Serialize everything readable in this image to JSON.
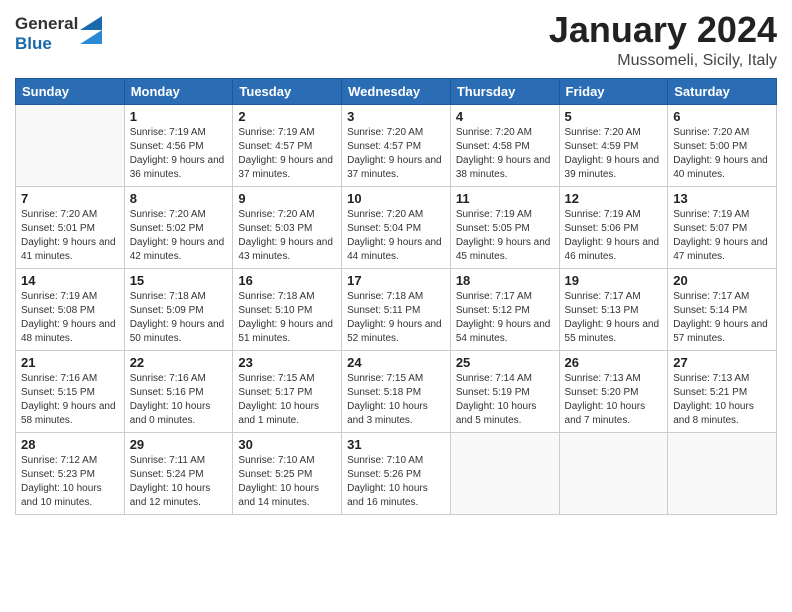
{
  "header": {
    "logo_general": "General",
    "logo_blue": "Blue",
    "month_title": "January 2024",
    "location": "Mussomeli, Sicily, Italy"
  },
  "days_of_week": [
    "Sunday",
    "Monday",
    "Tuesday",
    "Wednesday",
    "Thursday",
    "Friday",
    "Saturday"
  ],
  "weeks": [
    [
      {
        "day": "",
        "sunrise": "",
        "sunset": "",
        "daylight": "",
        "empty": true
      },
      {
        "day": "1",
        "sunrise": "Sunrise: 7:19 AM",
        "sunset": "Sunset: 4:56 PM",
        "daylight": "Daylight: 9 hours and 36 minutes."
      },
      {
        "day": "2",
        "sunrise": "Sunrise: 7:19 AM",
        "sunset": "Sunset: 4:57 PM",
        "daylight": "Daylight: 9 hours and 37 minutes."
      },
      {
        "day": "3",
        "sunrise": "Sunrise: 7:20 AM",
        "sunset": "Sunset: 4:57 PM",
        "daylight": "Daylight: 9 hours and 37 minutes."
      },
      {
        "day": "4",
        "sunrise": "Sunrise: 7:20 AM",
        "sunset": "Sunset: 4:58 PM",
        "daylight": "Daylight: 9 hours and 38 minutes."
      },
      {
        "day": "5",
        "sunrise": "Sunrise: 7:20 AM",
        "sunset": "Sunset: 4:59 PM",
        "daylight": "Daylight: 9 hours and 39 minutes."
      },
      {
        "day": "6",
        "sunrise": "Sunrise: 7:20 AM",
        "sunset": "Sunset: 5:00 PM",
        "daylight": "Daylight: 9 hours and 40 minutes."
      }
    ],
    [
      {
        "day": "7",
        "sunrise": "Sunrise: 7:20 AM",
        "sunset": "Sunset: 5:01 PM",
        "daylight": "Daylight: 9 hours and 41 minutes."
      },
      {
        "day": "8",
        "sunrise": "Sunrise: 7:20 AM",
        "sunset": "Sunset: 5:02 PM",
        "daylight": "Daylight: 9 hours and 42 minutes."
      },
      {
        "day": "9",
        "sunrise": "Sunrise: 7:20 AM",
        "sunset": "Sunset: 5:03 PM",
        "daylight": "Daylight: 9 hours and 43 minutes."
      },
      {
        "day": "10",
        "sunrise": "Sunrise: 7:20 AM",
        "sunset": "Sunset: 5:04 PM",
        "daylight": "Daylight: 9 hours and 44 minutes."
      },
      {
        "day": "11",
        "sunrise": "Sunrise: 7:19 AM",
        "sunset": "Sunset: 5:05 PM",
        "daylight": "Daylight: 9 hours and 45 minutes."
      },
      {
        "day": "12",
        "sunrise": "Sunrise: 7:19 AM",
        "sunset": "Sunset: 5:06 PM",
        "daylight": "Daylight: 9 hours and 46 minutes."
      },
      {
        "day": "13",
        "sunrise": "Sunrise: 7:19 AM",
        "sunset": "Sunset: 5:07 PM",
        "daylight": "Daylight: 9 hours and 47 minutes."
      }
    ],
    [
      {
        "day": "14",
        "sunrise": "Sunrise: 7:19 AM",
        "sunset": "Sunset: 5:08 PM",
        "daylight": "Daylight: 9 hours and 48 minutes."
      },
      {
        "day": "15",
        "sunrise": "Sunrise: 7:18 AM",
        "sunset": "Sunset: 5:09 PM",
        "daylight": "Daylight: 9 hours and 50 minutes."
      },
      {
        "day": "16",
        "sunrise": "Sunrise: 7:18 AM",
        "sunset": "Sunset: 5:10 PM",
        "daylight": "Daylight: 9 hours and 51 minutes."
      },
      {
        "day": "17",
        "sunrise": "Sunrise: 7:18 AM",
        "sunset": "Sunset: 5:11 PM",
        "daylight": "Daylight: 9 hours and 52 minutes."
      },
      {
        "day": "18",
        "sunrise": "Sunrise: 7:17 AM",
        "sunset": "Sunset: 5:12 PM",
        "daylight": "Daylight: 9 hours and 54 minutes."
      },
      {
        "day": "19",
        "sunrise": "Sunrise: 7:17 AM",
        "sunset": "Sunset: 5:13 PM",
        "daylight": "Daylight: 9 hours and 55 minutes."
      },
      {
        "day": "20",
        "sunrise": "Sunrise: 7:17 AM",
        "sunset": "Sunset: 5:14 PM",
        "daylight": "Daylight: 9 hours and 57 minutes."
      }
    ],
    [
      {
        "day": "21",
        "sunrise": "Sunrise: 7:16 AM",
        "sunset": "Sunset: 5:15 PM",
        "daylight": "Daylight: 9 hours and 58 minutes."
      },
      {
        "day": "22",
        "sunrise": "Sunrise: 7:16 AM",
        "sunset": "Sunset: 5:16 PM",
        "daylight": "Daylight: 10 hours and 0 minutes."
      },
      {
        "day": "23",
        "sunrise": "Sunrise: 7:15 AM",
        "sunset": "Sunset: 5:17 PM",
        "daylight": "Daylight: 10 hours and 1 minute."
      },
      {
        "day": "24",
        "sunrise": "Sunrise: 7:15 AM",
        "sunset": "Sunset: 5:18 PM",
        "daylight": "Daylight: 10 hours and 3 minutes."
      },
      {
        "day": "25",
        "sunrise": "Sunrise: 7:14 AM",
        "sunset": "Sunset: 5:19 PM",
        "daylight": "Daylight: 10 hours and 5 minutes."
      },
      {
        "day": "26",
        "sunrise": "Sunrise: 7:13 AM",
        "sunset": "Sunset: 5:20 PM",
        "daylight": "Daylight: 10 hours and 7 minutes."
      },
      {
        "day": "27",
        "sunrise": "Sunrise: 7:13 AM",
        "sunset": "Sunset: 5:21 PM",
        "daylight": "Daylight: 10 hours and 8 minutes."
      }
    ],
    [
      {
        "day": "28",
        "sunrise": "Sunrise: 7:12 AM",
        "sunset": "Sunset: 5:23 PM",
        "daylight": "Daylight: 10 hours and 10 minutes."
      },
      {
        "day": "29",
        "sunrise": "Sunrise: 7:11 AM",
        "sunset": "Sunset: 5:24 PM",
        "daylight": "Daylight: 10 hours and 12 minutes."
      },
      {
        "day": "30",
        "sunrise": "Sunrise: 7:10 AM",
        "sunset": "Sunset: 5:25 PM",
        "daylight": "Daylight: 10 hours and 14 minutes."
      },
      {
        "day": "31",
        "sunrise": "Sunrise: 7:10 AM",
        "sunset": "Sunset: 5:26 PM",
        "daylight": "Daylight: 10 hours and 16 minutes."
      },
      {
        "day": "",
        "sunrise": "",
        "sunset": "",
        "daylight": "",
        "empty": true
      },
      {
        "day": "",
        "sunrise": "",
        "sunset": "",
        "daylight": "",
        "empty": true
      },
      {
        "day": "",
        "sunrise": "",
        "sunset": "",
        "daylight": "",
        "empty": true
      }
    ]
  ]
}
